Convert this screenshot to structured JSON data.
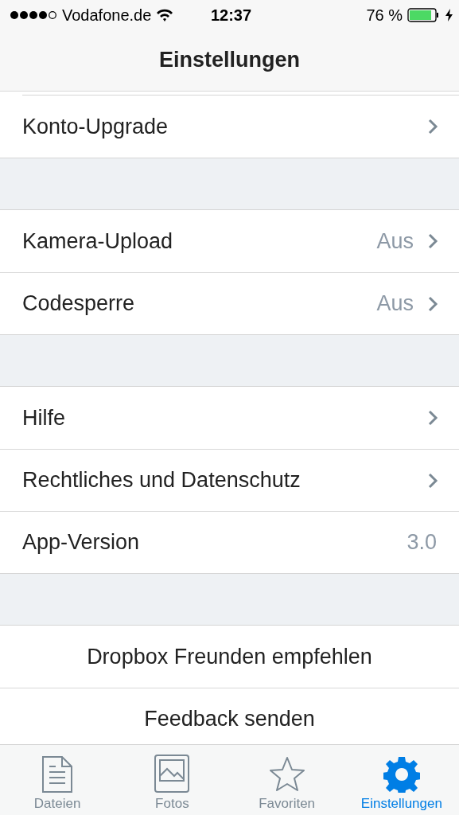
{
  "status_bar": {
    "carrier": "Vodafone.de",
    "time": "12:37",
    "battery": "76 %"
  },
  "nav_bar": {
    "title": "Einstellungen"
  },
  "sections": [
    {
      "rows": [
        {
          "kind": "link",
          "label": "Konto-Upgrade"
        }
      ]
    },
    {
      "rows": [
        {
          "kind": "link",
          "label": "Kamera-Upload",
          "value": "Aus"
        },
        {
          "kind": "link",
          "label": "Codesperre",
          "value": "Aus"
        }
      ]
    },
    {
      "rows": [
        {
          "kind": "link",
          "label": "Hilfe"
        },
        {
          "kind": "link",
          "label": "Rechtliches und Datenschutz"
        },
        {
          "kind": "info",
          "label": "App-Version",
          "value": "3.0"
        }
      ]
    },
    {
      "rows": [
        {
          "kind": "action",
          "label": "Dropbox Freunden empfehlen"
        },
        {
          "kind": "action",
          "label": "Feedback senden"
        }
      ]
    }
  ],
  "tabs": [
    {
      "kind": "file",
      "label": "Dateien",
      "selected": false
    },
    {
      "kind": "photo",
      "label": "Fotos",
      "selected": false
    },
    {
      "kind": "star",
      "label": "Favoriten",
      "selected": false
    },
    {
      "kind": "gear",
      "label": "Einstellungen",
      "selected": true
    }
  ]
}
